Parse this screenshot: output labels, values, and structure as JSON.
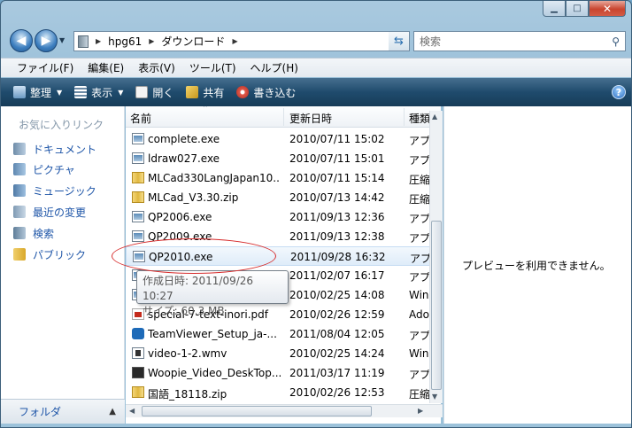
{
  "address": {
    "crumbs": [
      "hpg61",
      "ダウンロード"
    ]
  },
  "search": {
    "placeholder": "検索"
  },
  "menu": [
    "ファイル(F)",
    "編集(E)",
    "表示(V)",
    "ツール(T)",
    "ヘルプ(H)"
  ],
  "commands": [
    {
      "label": "整理",
      "icon": "organize-icon",
      "dropdown": true
    },
    {
      "label": "表示",
      "icon": "views-icon",
      "dropdown": true
    },
    {
      "label": "開く",
      "icon": "open-icon",
      "dropdown": false
    },
    {
      "label": "共有",
      "icon": "share-icon",
      "dropdown": false
    },
    {
      "label": "書き込む",
      "icon": "burn-icon",
      "dropdown": false
    }
  ],
  "nav": {
    "header": "お気に入りリンク",
    "links": [
      "ドキュメント",
      "ピクチャ",
      "ミュージック",
      "最近の変更",
      "検索",
      "パブリック"
    ],
    "folders_label": "フォルダ"
  },
  "columns": {
    "name": "名前",
    "date": "更新日時",
    "type": "種類"
  },
  "files": [
    {
      "name": "complete.exe",
      "date": "2010/07/11 15:02",
      "type": "アプ",
      "icon": "exe"
    },
    {
      "name": "ldraw027.exe",
      "date": "2010/07/11 15:01",
      "type": "アプ",
      "icon": "exe"
    },
    {
      "name": "MLCad330LangJapan10...",
      "date": "2010/07/11 15:14",
      "type": "圧縮",
      "icon": "zip"
    },
    {
      "name": "MLCad_V3.30.zip",
      "date": "2010/07/13 14:42",
      "type": "圧縮",
      "icon": "zip"
    },
    {
      "name": "QP2006.exe",
      "date": "2011/09/13 12:36",
      "type": "アプ",
      "icon": "exe"
    },
    {
      "name": "QP2009.exe",
      "date": "2011/09/13 12:38",
      "type": "アプ",
      "icon": "exe"
    },
    {
      "name": "QP2010.exe",
      "date": "2011/09/28 16:32",
      "type": "アプ",
      "icon": "exe",
      "highlighted": true
    },
    {
      "name": "",
      "date": "2011/02/07 16:17",
      "type": "アプ",
      "icon": "exe"
    },
    {
      "name": "",
      "date": "2010/02/25 14:08",
      "type": "Win",
      "icon": "exe"
    },
    {
      "name": "special-7-text-inori.pdf",
      "date": "2010/02/26 12:59",
      "type": "Ado",
      "icon": "pdf"
    },
    {
      "name": "TeamViewer_Setup_ja-...",
      "date": "2011/08/04 12:05",
      "type": "アプ",
      "icon": "tv"
    },
    {
      "name": "video-1-2.wmv",
      "date": "2010/02/25 14:24",
      "type": "Win",
      "icon": "wmv"
    },
    {
      "name": "Woopie_Video_DeskTop...",
      "date": "2011/03/17 11:19",
      "type": "アプ",
      "icon": "wv"
    },
    {
      "name": "国語_18118.zip",
      "date": "2010/02/26 12:53",
      "type": "圧縮",
      "icon": "zip"
    }
  ],
  "tooltip": {
    "line1": "作成日時: 2011/09/26 10:27",
    "line2": "サイズ: 60.3 MB"
  },
  "preview": {
    "message": "プレビューを利用できません。"
  },
  "colors": {
    "command_bar": "#1f4b6d",
    "link": "#1f56a8",
    "highlight_ellipse": "#d62a2a"
  }
}
